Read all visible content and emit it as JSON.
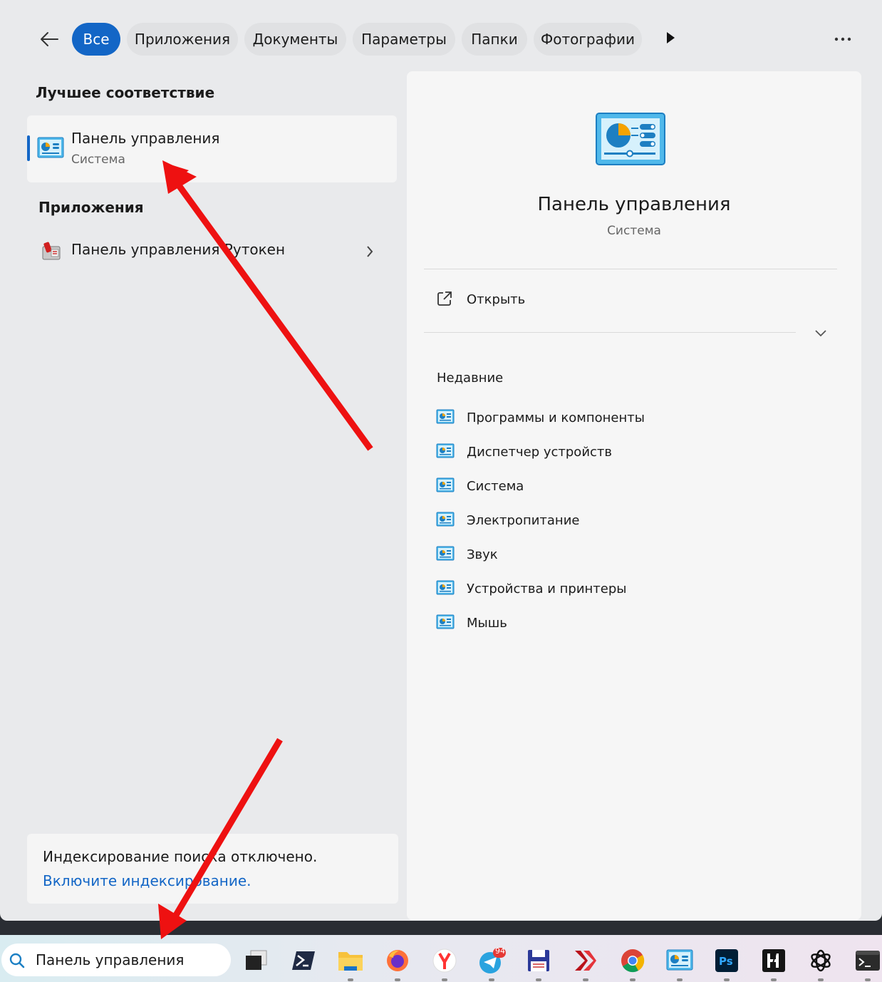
{
  "filters": {
    "all": "Все",
    "apps": "Приложения",
    "documents": "Документы",
    "settings": "Параметры",
    "folders": "Папки",
    "photos": "Фотографии"
  },
  "best_match": {
    "heading": "Лучшее соответствие",
    "title": "Панель управления",
    "subtitle": "Система"
  },
  "apps_section": {
    "heading": "Приложения",
    "item": "Панель управления Рутокен"
  },
  "indexing": {
    "message": "Индексирование поиска отключено.",
    "link": "Включите индексирование."
  },
  "detail": {
    "title": "Панель управления",
    "subtitle": "Система",
    "open_label": "Открыть",
    "recent_heading": "Недавние",
    "recent": [
      "Программы и компоненты",
      "Диспетчер устройств",
      "Система",
      "Электропитание",
      "Звук",
      "Устройства и принтеры",
      "Мышь"
    ]
  },
  "taskbar": {
    "search_value": "Панель управления",
    "telegram_badge": "94",
    "apps": [
      "task-view",
      "powershell",
      "file-explorer",
      "firefox",
      "yandex-browser",
      "telegram",
      "save-app",
      "xmind",
      "chrome",
      "control-panel",
      "photoshop",
      "h-app",
      "chatgpt",
      "terminal"
    ]
  },
  "colors": {
    "accent": "#1366c6",
    "arrow": "#ee1111"
  }
}
